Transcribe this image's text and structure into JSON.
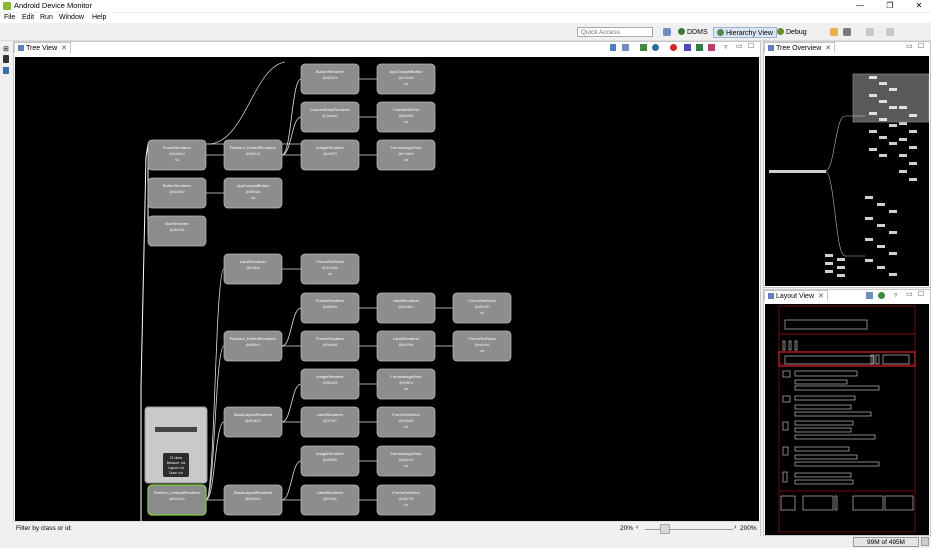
{
  "window": {
    "title": "Android Device Monitor",
    "minimize": "—",
    "restore": "❐",
    "close": "✕"
  },
  "menu": [
    "File",
    "Edit",
    "Run",
    "Window",
    "Help"
  ],
  "toolbar": {
    "quick_access_placeholder": "Quick Access",
    "perspectives": [
      "DDMS",
      "Hierarchy View",
      "Debug"
    ]
  },
  "tree_view": {
    "tab_label": "Tree View",
    "filter_label": "Filter by class or id:",
    "zoom_min": "20%",
    "zoom_max": "200%",
    "zoom_current": "20%"
  },
  "tree_overview": {
    "tab_label": "Tree Overview"
  },
  "layout_view": {
    "tab_label": "Layout View"
  },
  "status": {
    "memory": "99M of 495M"
  },
  "nodes": [
    {
      "title": "ButtonRenderer",
      "id": "@fd0087a",
      "sub": ""
    },
    {
      "title": "AppCompatButton",
      "id": "@e7c1a5b",
      "sub": "n/a"
    },
    {
      "title": "CustomEntryRenderer",
      "id": "@7aaeed2",
      "sub": ""
    },
    {
      "title": "FormsEditText",
      "id": "@6c4df08",
      "sub": "n/a"
    },
    {
      "title": "ImageRenderer",
      "id": "@4b52f7f",
      "sub": ""
    },
    {
      "title": "FormsImageView",
      "id": "@b7e4b5d",
      "sub": "n/a"
    },
    {
      "title": "FrameRenderer",
      "id": "@1b6a0c3",
      "sub": "n/a"
    },
    {
      "title": "Platform_DefaultRenderer",
      "id": "@5e5f7a3",
      "sub": ""
    },
    {
      "title": "ButtonRenderer",
      "id": "@2da8c90",
      "sub": ""
    },
    {
      "title": "AppCompatButton",
      "id": "@f65b43a",
      "sub": "n/a"
    },
    {
      "title": "BoxRenderer",
      "id": "@4e61dfe",
      "sub": ""
    },
    {
      "title": "LabelRenderer",
      "id": "@b1f0bfe",
      "sub": ""
    },
    {
      "title": "FormsTextView",
      "id": "@7e7a1db",
      "sub": "n/a"
    },
    {
      "title": "FrameRenderer",
      "id": "@a8e6bfc",
      "sub": ""
    },
    {
      "title": "LabelRenderer",
      "id": "@e62d8b4",
      "sub": ""
    },
    {
      "title": "FormsTextView",
      "id": "@a6f2490",
      "sub": "n/a"
    },
    {
      "title": "Platform_DefaultRenderer",
      "id": "@e8f8bc1",
      "sub": ""
    },
    {
      "title": "FrameRenderer",
      "id": "@f0eddb4",
      "sub": ""
    },
    {
      "title": "LabelRenderer",
      "id": "@6e10f9e",
      "sub": ""
    },
    {
      "title": "FormsTextView",
      "id": "@ea1a3ef",
      "sub": "n/a"
    },
    {
      "title": "ImageRenderer",
      "id": "@f06a625",
      "sub": ""
    },
    {
      "title": "FormsImageView",
      "id": "@7bf5f7a",
      "sub": "n/a"
    },
    {
      "title": "StackLayoutRenderer",
      "id": "@e81d023",
      "sub": ""
    },
    {
      "title": "LabelRenderer",
      "id": "@2f77fe1",
      "sub": ""
    },
    {
      "title": "FormsTextView",
      "id": "@623bfc8",
      "sub": "n/a"
    },
    {
      "title": "ImageRenderer",
      "id": "@c065f4c",
      "sub": ""
    },
    {
      "title": "FormsImageView",
      "id": "@a4be2f1",
      "sub": "n/a"
    },
    {
      "title": "StackLayoutRenderer",
      "id": "@d5b0d4e",
      "sub": ""
    },
    {
      "title": "LabelRenderer",
      "id": "@fe2f9ac",
      "sub": ""
    },
    {
      "title": "FormsTextView",
      "id": "@4f40796",
      "sub": "n/a"
    },
    {
      "title": "Platform_DefaultRenderer",
      "id": "@9ba0146",
      "sub": ""
    }
  ],
  "selected_tooltip": {
    "lines": [
      "22 views",
      "Measure: n/a",
      "Layout: n/a",
      "Draw: n/a"
    ]
  }
}
